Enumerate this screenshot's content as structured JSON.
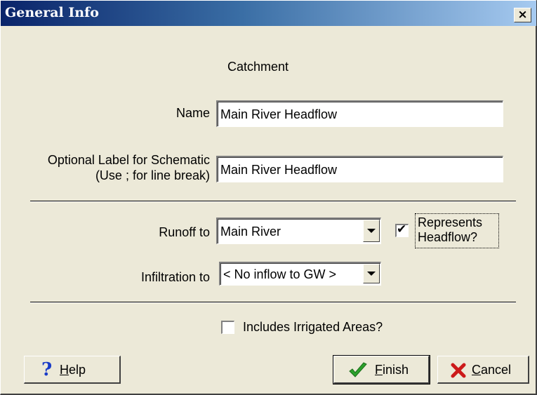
{
  "window": {
    "title": "General Info",
    "close_glyph": "×"
  },
  "heading": "Catchment",
  "name": {
    "label": "Name",
    "value": "Main River Headflow"
  },
  "schematic": {
    "label_line1": "Optional Label for Schematic",
    "label_line2": "(Use ; for line break)",
    "value": "Main River Headflow"
  },
  "runoff": {
    "label": "Runoff to",
    "selected": "Main River",
    "headflow_checked": true,
    "headflow_label_line1": "Represents",
    "headflow_label_line2": "Headflow?"
  },
  "infiltration": {
    "label": "Infiltration to",
    "selected": "< No inflow to GW >"
  },
  "irrigated": {
    "label": "Includes Irrigated Areas?",
    "checked": false
  },
  "buttons": {
    "help": {
      "mnemonic": "H",
      "rest": "elp",
      "icon": "question-icon"
    },
    "finish": {
      "mnemonic": "F",
      "rest": "inish",
      "icon": "checkmark-icon"
    },
    "cancel": {
      "mnemonic": "C",
      "rest": "ancel",
      "icon": "x-icon"
    }
  },
  "colors": {
    "titlebar_start": "#0a246a",
    "titlebar_end": "#a6caf0",
    "face": "#ece9d8",
    "help_icon": "#1a3cc8",
    "finish_icon": "#2ca02c",
    "cancel_icon": "#cc1a1a"
  }
}
